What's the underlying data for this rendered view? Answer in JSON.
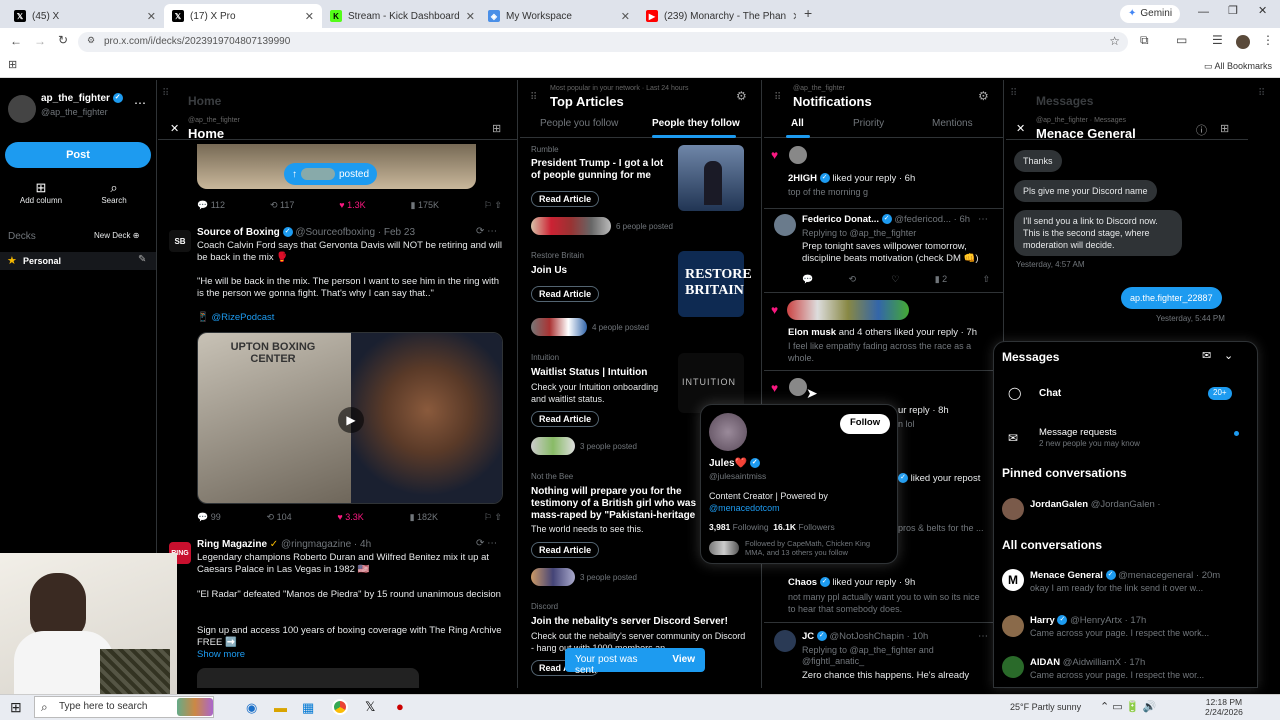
{
  "browser": {
    "tabs": [
      {
        "title": "(45) X",
        "active": false
      },
      {
        "title": "(17) X Pro",
        "active": true
      },
      {
        "title": "Stream - Kick Dashboard",
        "active": false
      },
      {
        "title": "My Workspace",
        "active": false
      },
      {
        "title": "(239) Monarchy - The Phan",
        "active": false
      }
    ],
    "gemini_label": "Gemini",
    "url": "pro.x.com/i/decks/2023919704807139990",
    "all_bookmarks": "All Bookmarks"
  },
  "sidebar": {
    "username": "ap_the_fighter",
    "handle": "@ap_the_fighter",
    "post_label": "Post",
    "add_column_label": "Add column",
    "search_label": "Search",
    "decks_label": "Decks",
    "new_deck_label": "New Deck",
    "personal_label": "Personal"
  },
  "home_column": {
    "ghost_title": "Home",
    "account": "@ap_the_fighter",
    "title": "Home",
    "posted_pill": "posted",
    "stats1": {
      "replies": "112",
      "reposts": "117",
      "likes": "1.3K",
      "views": "175K"
    },
    "tweet1": {
      "name": "Source of Boxing",
      "handle": "@Sourceofboxing · Feb 23",
      "avatar_text": "SB",
      "text1": "Coach Calvin Ford says that Gervonta Davis will NOT be retiring and will be back in the mix 🥊",
      "text2": "\"He will be back in the mix. The person I want to see him in the ring with is the person we gonna fight. That's why I can say that..\"",
      "mention": "📱 @RizePodcast",
      "thumb_text": "UPTON BOXING CENTER"
    },
    "stats2": {
      "replies": "99",
      "reposts": "104",
      "likes": "3.3K",
      "views": "182K"
    },
    "tweet2": {
      "name": "Ring Magazine",
      "handle": "@ringmagazine · 4h",
      "avatar_text": "RING",
      "text1": "Legendary champions Roberto Duran and Wilfred Benitez mix it up at Caesars Palace in Las Vegas in 1982 🇺🇸",
      "text2": "\"El Radar\" defeated \"Manos de Piedra\" by 15 round unanimous decision",
      "text3": "Sign up and access 100 years of boxing coverage with The Ring Archive FREE ➡️",
      "show_more": "Show more"
    }
  },
  "articles_column": {
    "subtitle": "Most popular in your network · Last 24 hours",
    "title": "Top Articles",
    "tab1": "People you follow",
    "tab2": "People they follow",
    "read_label": "Read Article",
    "articles": [
      {
        "source": "Rumble",
        "title": "President Trump - I got a lot of people gunning for me",
        "desc": "",
        "posted": "6 people posted"
      },
      {
        "source": "Restore Britain",
        "title": "Join Us",
        "desc": "",
        "posted": "4 people posted",
        "thumb": "RESTORE BRITAIN"
      },
      {
        "source": "Intuition",
        "title": "Waitlist Status | Intuition",
        "desc": "Check your Intuition onboarding and waitlist status.",
        "posted": "3 people posted",
        "thumb": "INTUITION"
      },
      {
        "source": "Not the Bee",
        "title": "Nothing will prepare you for the testimony of a British girl who was mass-raped by \"Pakistani-heritage men,\" including",
        "desc": "The world needs to see this.",
        "posted": "3 people posted"
      },
      {
        "source": "Discord",
        "title": "Join the nebality's server Discord Server!",
        "desc": "Check out the nebality's server community on Discord - hang out with 1000 members an...",
        "posted": ""
      }
    ],
    "toast_text": "Your post was sent.",
    "toast_action": "View"
  },
  "notifications_column": {
    "subtitle": "@ap_the_fighter",
    "title": "Notifications",
    "tabs": [
      "All",
      "Priority",
      "Mentions"
    ],
    "items": [
      {
        "name": "2HIGH",
        "action": "liked your reply · 6h",
        "preview": "top of the morning g"
      },
      {
        "name": "Federico Donat...",
        "handle": "@federicod... · 6h",
        "reply_to": "Replying to @ap_the_fighter",
        "text": "Prep tonight saves willpower tomorrow, discipline beats motivation (check DM 👊)",
        "likes": "2"
      },
      {
        "name": "Elon musk",
        "action": "and 4 others liked your reply · 7h",
        "preview": "I feel like empathy fading across the race as a whole."
      },
      {
        "action_partial": "ur reply · 8h",
        "preview_partial": "n lol"
      },
      {
        "action_partial": "liked your repost"
      },
      {
        "preview_partial": "pros & belts for the ..."
      },
      {
        "name": "Chaos",
        "action": "liked your reply · 9h",
        "preview": "not many ppl actually want you to win so its nice to hear that somebody does."
      },
      {
        "name": "JC",
        "handle": "@NotJoshChapin · 10h",
        "reply_to": "Replying to @ap_the_fighter and @fightl_anatic_",
        "text": "Zero chance this happens. He's already"
      }
    ]
  },
  "hover_card": {
    "name": "Jules❤️",
    "handle": "@julesaintmiss",
    "follow_label": "Follow",
    "bio": "Content Creator | Powered by",
    "bio_link": "@menacedotcom",
    "following_count": "3,981",
    "following_label": "Following",
    "followers_count": "16.1K",
    "followers_label": "Followers",
    "followed_by": "Followed by CapeMath, Chicken King MMA, and 13 others you follow"
  },
  "messages_column": {
    "ghost_title": "Messages",
    "subtitle": "@ap_the_fighter · Messages",
    "title": "Menace General",
    "bubbles": [
      {
        "text": "Thanks",
        "side": "left"
      },
      {
        "text": "Pls give me your Discord name",
        "side": "left"
      },
      {
        "text": "I'll send you a link to Discord now. This is the second stage, where moderation will decide.",
        "side": "left"
      }
    ],
    "time1": "Yesterday, 4:57 AM",
    "my_bubble": "ap.the.fighter_22887",
    "time2": "Yesterday, 5:44 PM"
  },
  "messages_drawer": {
    "title": "Messages",
    "chat_label": "Chat",
    "chat_badge": "20+",
    "requests_label": "Message requests",
    "requests_sub": "2 new people you may know",
    "pinned_header": "Pinned conversations",
    "pinned": [
      {
        "name": "JordanGalen",
        "handle": "@JordanGalen ·"
      }
    ],
    "all_header": "All conversations",
    "conversations": [
      {
        "name": "Menace General",
        "handle": "@menacegeneral · 20m",
        "preview": "okay I am ready for the link send it over w..."
      },
      {
        "name": "Harry",
        "handle": "@HenryArtx · 17h",
        "preview": "Came across your page. I respect the work..."
      },
      {
        "name": "AIDAN",
        "handle": "@AidwilliamX · 17h",
        "preview": "Came across your page. I respect the wor..."
      }
    ]
  },
  "taskbar": {
    "search_placeholder": "Type here to search",
    "weather": "25°F  Partly sunny",
    "time": "12:18 PM",
    "date": "2/24/2026"
  }
}
